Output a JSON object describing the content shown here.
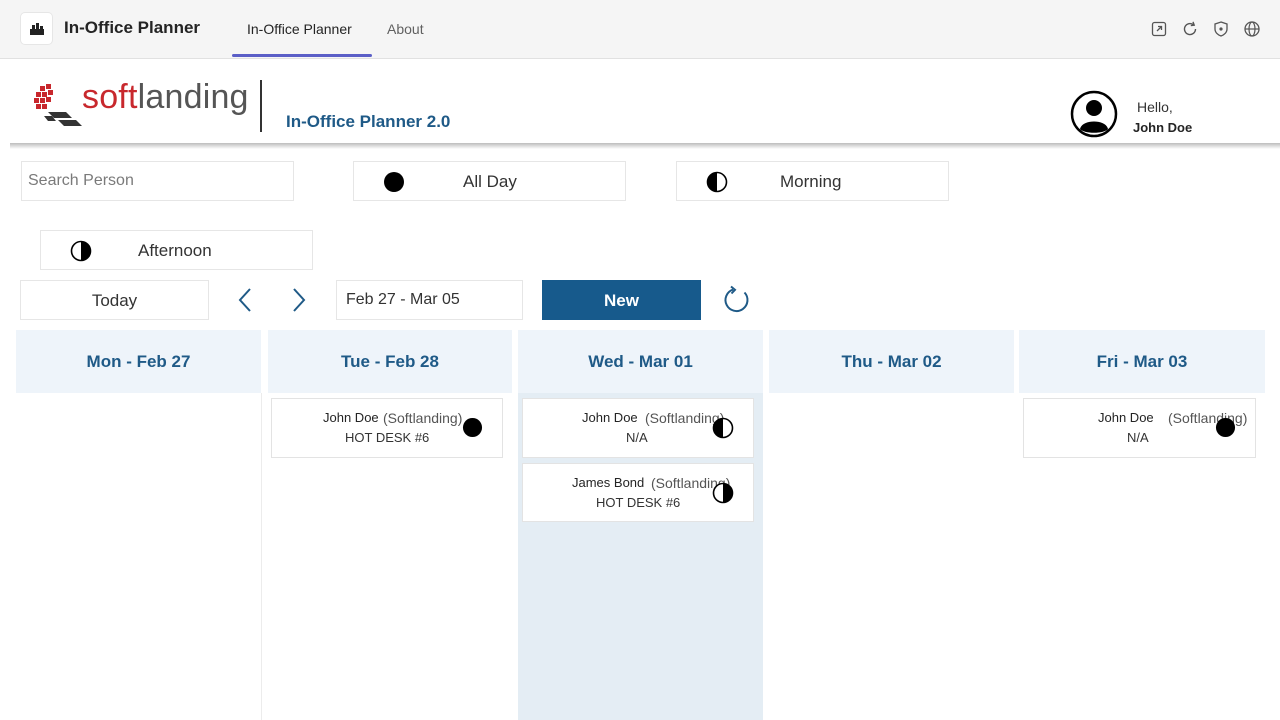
{
  "teams_bar": {
    "app_name": "In-Office Planner",
    "tabs": [
      {
        "label": "In-Office Planner",
        "active": true
      },
      {
        "label": "About",
        "active": false
      }
    ],
    "icons": [
      "popout-icon",
      "refresh-icon",
      "shield-icon",
      "globe-icon"
    ]
  },
  "header": {
    "logo_text_soft": "soft",
    "logo_text_landing": "landing",
    "title": "In-Office Planner 2.0",
    "greeting": "Hello,",
    "user_name": "John Doe"
  },
  "filters": {
    "search_placeholder": "Search Person",
    "all_day_label": "All Day",
    "morning_label": "Morning",
    "afternoon_label": "Afternoon"
  },
  "toolbar": {
    "today_label": "Today",
    "date_range": "Feb 27 - Mar 05",
    "new_label": "New"
  },
  "colors": {
    "accent": "#175a8c",
    "header_text": "#1f5a87",
    "day_header_bg": "#eef4fa",
    "selected_day_bg": "#e4edf4",
    "teams_tab_underline": "#5b5fc7",
    "logo_red": "#c8282d"
  },
  "calendar": {
    "days": [
      {
        "label": "Mon -  Feb 27",
        "selected": false,
        "entries": []
      },
      {
        "label": "Tue -  Feb 28",
        "selected": false,
        "entries": [
          {
            "name": "John Doe",
            "company": "(Softlanding)",
            "desk": "HOT DESK #6",
            "slot": "all-day"
          }
        ]
      },
      {
        "label": "Wed -  Mar 01",
        "selected": true,
        "entries": [
          {
            "name": "John Doe",
            "company": "(Softlanding)",
            "desk": "N/A",
            "slot": "morning"
          },
          {
            "name": "James Bond",
            "company": "(Softlanding)",
            "desk": "HOT DESK #6",
            "slot": "afternoon"
          }
        ]
      },
      {
        "label": "Thu -  Mar 02",
        "selected": false,
        "entries": []
      },
      {
        "label": "Fri -  Mar 03",
        "selected": false,
        "entries": [
          {
            "name": "John Doe",
            "company": "(Softlanding)",
            "desk": "N/A",
            "slot": "all-day"
          }
        ]
      }
    ]
  }
}
